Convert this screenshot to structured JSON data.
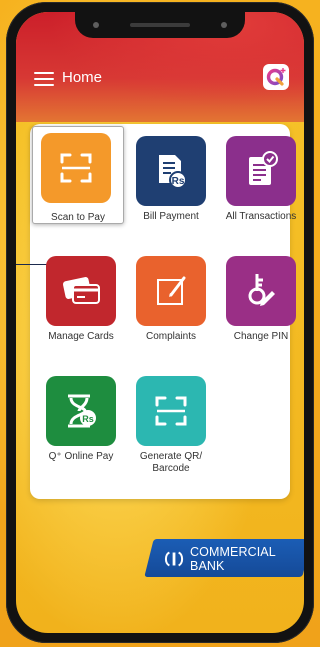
{
  "header": {
    "title": "Home"
  },
  "tiles": [
    {
      "label": "Scan to Pay",
      "color": "#f4992a",
      "icon": "scan-icon"
    },
    {
      "label": "Bill Payment",
      "color": "#1f3f72",
      "icon": "bill-icon"
    },
    {
      "label": "All Transactions",
      "color": "#8b2f8c",
      "icon": "transactions-icon"
    },
    {
      "label": "Manage Cards",
      "color": "#c1272d",
      "icon": "cards-icon"
    },
    {
      "label": "Complaints",
      "color": "#e9622d",
      "icon": "complaint-icon"
    },
    {
      "label": "Change PIN",
      "color": "#9a2f86",
      "icon": "pin-icon"
    },
    {
      "label": "Q⁺ Online Pay",
      "color": "#1e8d3f",
      "icon": "hourglass-rs-icon"
    },
    {
      "label": "Generate QR/ Barcode",
      "color": "#2cb7b1",
      "icon": "qr-generate-icon"
    }
  ],
  "bank": {
    "name": "COMMERCIAL BANK",
    "color": "#1a56ad"
  },
  "colors": {
    "accent": "#cc1f2a",
    "background": "#f6b21f"
  }
}
